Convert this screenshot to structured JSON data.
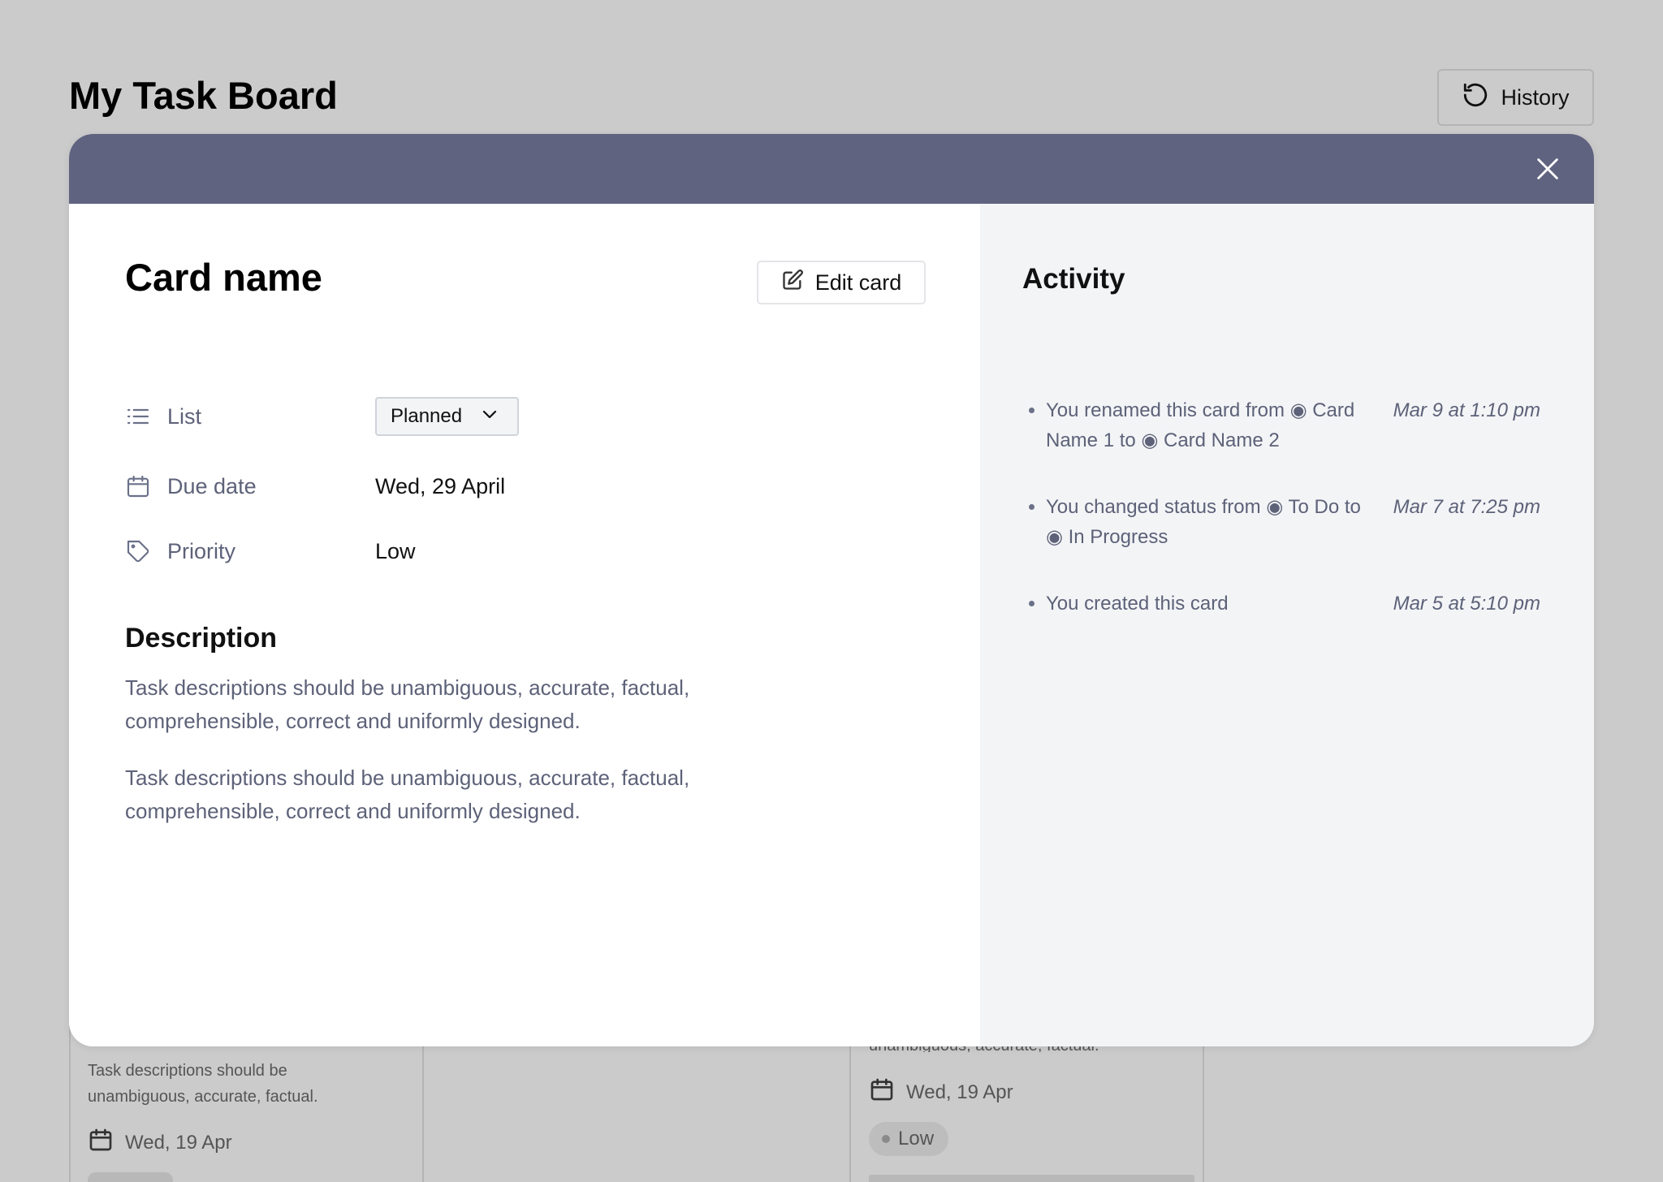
{
  "board": {
    "title": "My Task Board",
    "history_label": "History"
  },
  "background_cards": [
    {
      "description": "Task descriptions should be unambiguous, accurate, factual.",
      "date": "Wed, 19 Apr"
    },
    {
      "description_partial": "unambiguous, accurate, factual.",
      "date": "Wed, 19 Apr",
      "priority": "Low"
    }
  ],
  "modal": {
    "card_name": "Card name",
    "edit_label": "Edit card",
    "properties": {
      "list_label": "List",
      "list_value": "Planned",
      "due_label": "Due date",
      "due_value": "Wed, 29 April",
      "priority_label": "Priority",
      "priority_value": "Low"
    },
    "description_title": "Description",
    "description_paragraphs": [
      "Task descriptions should be unambiguous, accurate, factual, comprehensible, correct and uniformly designed.",
      "Task descriptions should be unambiguous, accurate, factual, comprehensible, correct and uniformly designed."
    ],
    "activity_title": "Activity",
    "activity": [
      {
        "text": "You renamed this card from ◉ Card Name 1 to ◉ Card Name 2",
        "time": "Mar 9 at 1:10 pm"
      },
      {
        "text": "You changed status from ◉ To Do to ◉ In Progress",
        "time": "Mar 7 at 7:25 pm"
      },
      {
        "text": "You created this card",
        "time": "Mar 5 at 5:10 pm"
      }
    ]
  },
  "icons": [
    "history-icon",
    "close-icon",
    "edit-icon",
    "list-icon",
    "calendar-icon",
    "tag-icon",
    "chevron-down-icon"
  ],
  "colors": {
    "overlay": "#cbcbcb",
    "modal_header": "#5f637f",
    "activity_bg": "#f3f4f6",
    "muted_text": "#5d6279"
  }
}
